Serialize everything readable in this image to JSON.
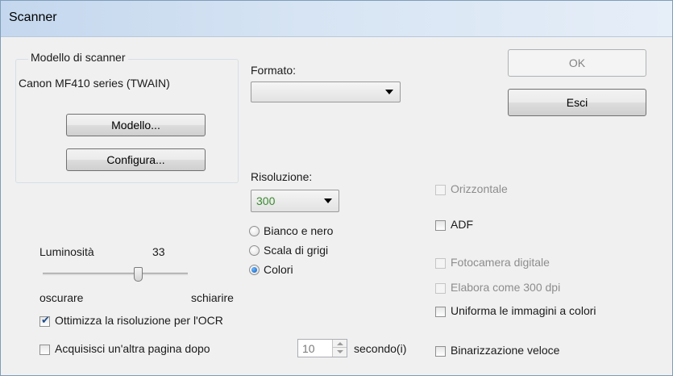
{
  "window": {
    "title": "Scanner"
  },
  "scanner_group": {
    "legend": "Modello di scanner",
    "model_name": "Canon MF410 series (TWAIN)",
    "model_button": "Modello...",
    "configure_button": "Configura..."
  },
  "format": {
    "label": "Formato:",
    "value": ""
  },
  "buttons": {
    "ok": "OK",
    "exit": "Esci"
  },
  "resolution": {
    "label": "Risoluzione:",
    "value": "300",
    "value_color": "#3a8a2e"
  },
  "color_mode": {
    "options": [
      "Bianco e nero",
      "Scala di grigi",
      "Colori"
    ],
    "selected": "Colori"
  },
  "brightness": {
    "label": "Luminosità",
    "value": "33",
    "min_label": "oscurare",
    "max_label": "schiarire",
    "level_fraction": 0.62
  },
  "options": {
    "optimize_ocr": {
      "label": "Ottimizza la risoluzione per l'OCR",
      "checked": true
    },
    "acquire_another": {
      "label": "Acquisisci un'altra pagina dopo",
      "checked": false
    },
    "delay": {
      "value": "10",
      "unit": "secondo(i)"
    },
    "horizontal": {
      "label": "Orizzontale",
      "checked": false,
      "enabled": false
    },
    "adf": {
      "label": "ADF",
      "checked": false,
      "enabled": true
    },
    "digital_camera": {
      "label": "Fotocamera digitale",
      "checked": false,
      "enabled": false
    },
    "process_300dpi": {
      "label": "Elabora come 300 dpi",
      "checked": false,
      "enabled": false
    },
    "uniform_color": {
      "label": "Uniforma le immagini a colori",
      "checked": false,
      "enabled": true
    },
    "fast_binarization": {
      "label": "Binarizzazione veloce",
      "checked": false,
      "enabled": true
    }
  },
  "icons": {
    "dropdown": "chevron-down-icon",
    "spin_up": "spin-up-icon",
    "spin_down": "spin-down-icon",
    "check": "check-icon"
  }
}
